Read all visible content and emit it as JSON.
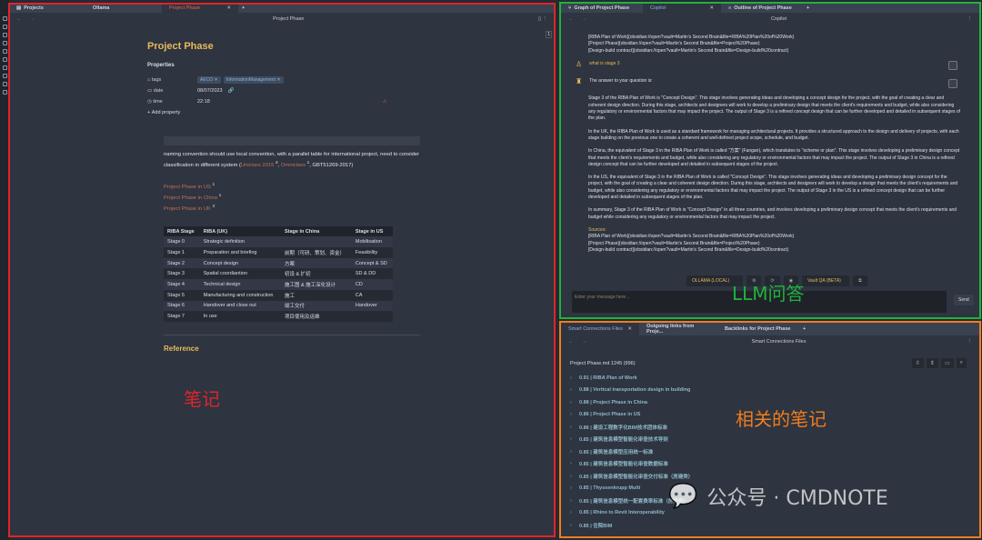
{
  "left_pane": {
    "tabs": [
      "Projects",
      "Ollama",
      "Project Phase"
    ],
    "header_title": "Project Phase",
    "page_number": "1",
    "title": "Project Phase",
    "properties_label": "Properties",
    "props": {
      "tags_label": "tags",
      "tags": [
        "AECO",
        "InformationManagement"
      ],
      "date_label": "date",
      "date": "08/07/2023",
      "time_label": "time",
      "time": "22:18",
      "add": "Add property"
    },
    "paragraph_a": "naming convention should use local convention, with a parallel table for international project, need to consider classification in different system (",
    "uniclass": "Uniclass 2015",
    "uniclass_count": "4",
    "omniclass": "Omniclass",
    "omniclass_count": "1",
    "paragraph_b": ", GBT51269-2017)",
    "links": [
      {
        "t": "Project Phase in US",
        "c": "1"
      },
      {
        "t": "Project Phase in China",
        "c": "1"
      },
      {
        "t": "Project Phase in UK",
        "c": "3"
      }
    ],
    "table": {
      "headers": [
        "RIBA Stage",
        "RIBA (UK)",
        "Stage in China",
        "Stage in US"
      ],
      "rows": [
        [
          "Stage 0",
          "Strategic definition",
          "",
          "Mobilisation"
        ],
        [
          "Stage 1",
          "Preparation and briefing",
          "前期（可研、策划、资金）",
          "Feasibility"
        ],
        [
          "Stage 2",
          "Concept design",
          "方案",
          "Concept & SD"
        ],
        [
          "Stage 3",
          "Spatial coordiantion",
          "初设 & 扩初",
          "SD & DD"
        ],
        [
          "Stage 4",
          "Technical design",
          "施工图 & 施工深化设计",
          "CD"
        ],
        [
          "Stage 5",
          "Manufacturing and construction",
          "施工",
          "CA"
        ],
        [
          "Stage 6",
          "Handover and close out",
          "竣工交付",
          "Handover"
        ],
        [
          "Stage 7",
          "In use",
          "项目使用及运维",
          ""
        ]
      ]
    },
    "reference": "Reference",
    "annotation": "笔记"
  },
  "copilot": {
    "tabs": [
      "Graph of Project Phase",
      "Copilot",
      "Outline of Project Phase"
    ],
    "header_title": "Copilot",
    "prev_sources": [
      "[RIBA Plan of Work](obsidian://open?vault=Martin's Second Brain&file=RIBA%20Plan%20of%20Work)",
      "[Project Phase](obsidian://open?vault=Martin's Second Brain&file=Project%20Phase)",
      "[Design-build contract](obsidian://open?vault=Martin's Second Brain&file=Design-build%20contract)"
    ],
    "user_msg": "what is stage 3",
    "answer_intro": "The answer to your question is:",
    "answer": [
      "Stage 3 of the RIBA Plan of Work is \"Concept Design\". This stage involves generating ideas and developing a concept design for the project, with the goal of creating a clear and coherent design direction. During this stage, architects and designers will work to develop a preliminary design that meets the client's requirements and budget, while also considering any regulatory or environmental factors that may impact the project. The output of Stage 3 is a refined concept design that can be further developed and detailed in subsequent stages of the plan.",
      "In the UK, the RIBA Plan of Work is used as a standard framework for managing architectural projects. It provides a structured approach to the design and delivery of projects, with each stage building on the previous one to create a coherent and well-defined project scope, schedule, and budget.",
      "In China, the equivalent of Stage 3 in the RIBA Plan of Work is called \"方案\" (Fangan), which translates to \"scheme or plan\". This stage involves developing a preliminary design concept that meets the client's requirements and budget, while also considering any regulatory or environmental factors that may impact the project. The output of Stage 3 in China is a refined design concept that can be further developed and detailed in subsequent stages of the project.",
      "In the US, the equivalent of Stage 3 in the RIBA Plan of Work is called \"Concept Design\". This stage involves generating ideas and developing a preliminary design concept for the project, with the goal of creating a clear and coherent design direction. During this stage, architects and designers will work to develop a design that meets the client's requirements and budget, while also considering any regulatory or environmental factors that may impact the project. The output of Stage 3 in the US is a refined concept design that can be further developed and detailed in subsequent stages of the plan.",
      "In summary, Stage 3 of the RIBA Plan of Work is \"Concept Design\" in all three countries, and involves developing a preliminary design concept that meets the client's requirements and budget while considering any regulatory or environmental factors that may impact the project."
    ],
    "sources_label": "Sources:",
    "sources": [
      "[RIBA Plan of Work](obsidian://open?vault=Martin's Second Brain&file=RIBA%20Plan%20of%20Work)",
      "[Project Phase](obsidian://open?vault=Martin's Second Brain&file=Project%20Phase)",
      "[Design-build contract](obsidian://open?vault=Martin's Second Brain&file=Design-build%20contract)"
    ],
    "model": "OLLAMA (LOCAL)",
    "mode": "Vault QA (BETA)",
    "placeholder": "Enter your message here...",
    "send": "Send",
    "annotation": "LLM问答"
  },
  "smart": {
    "tabs": [
      "Smart Connections Files",
      "Outgoing links from Proje...",
      "Backlinks for Project Phase"
    ],
    "header_title": "Smart Connections Files",
    "file_info": "Project Phase.md 1245 (996)",
    "items": [
      "0.91 | RIBA Plan of Work",
      "0.88 | Vertical transportation design in building",
      "0.88 | Project Phase in China",
      "0.86 | Project Phase in US",
      "0.86 | 建设工程数字化BIM技术团体标准",
      "0.85 | 建筑信息模型智能化审查技术导则",
      "0.85 | 建筑信息模型应用统一标准",
      "0.85 | 建筑信息模型智能化审查数据标准",
      "0.85 | 建筑信息模型智能化审查交付标准（房建类）",
      "0.85 | Thyssenkrupp Multi",
      "0.85 | 建筑信息模型统一配套费率标准（房建类）",
      "0.85 | Rhino to Revit Interoperability",
      "0.85 | 住院BIM"
    ],
    "annotation": "相关的笔记"
  },
  "watermark": "公众号 · CMDNOTE",
  "colors": {
    "red": "#e0242a",
    "green": "#1fb33c",
    "orange": "#f07d1e",
    "accent": "#e8b95a"
  }
}
